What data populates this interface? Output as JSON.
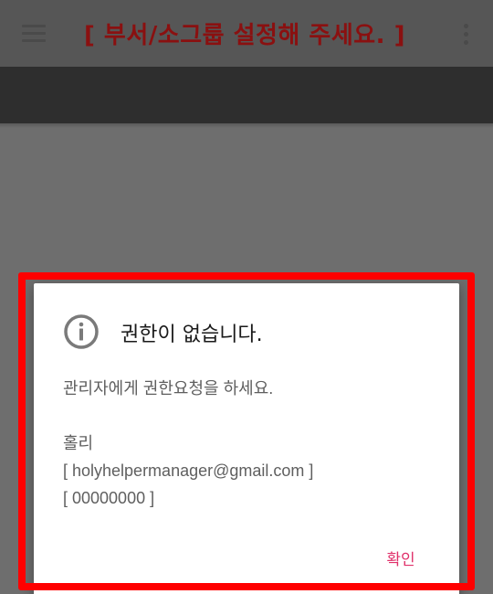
{
  "app_bar": {
    "title": "[ 부서/소그룹 설정해 주세요. ]",
    "menu_icon": "hamburger-menu-icon",
    "more_icon": "more-vertical-icon"
  },
  "dialog": {
    "icon": "info-icon",
    "title": "권한이 없습니다.",
    "message_lines": [
      "관리자에게 권한요청을 하세요.",
      "",
      "홀리",
      "[ holyhelpermanager@gmail.com ]",
      "[ 00000000 ]"
    ],
    "confirm_label": "확인"
  },
  "colors": {
    "scrim": "#6e6e6e",
    "app_bar": "#565656",
    "title_text": "#8a1010",
    "highlight_frame": "#ff0000",
    "dialog_bg": "#ffffff",
    "accent": "#e0306a"
  }
}
